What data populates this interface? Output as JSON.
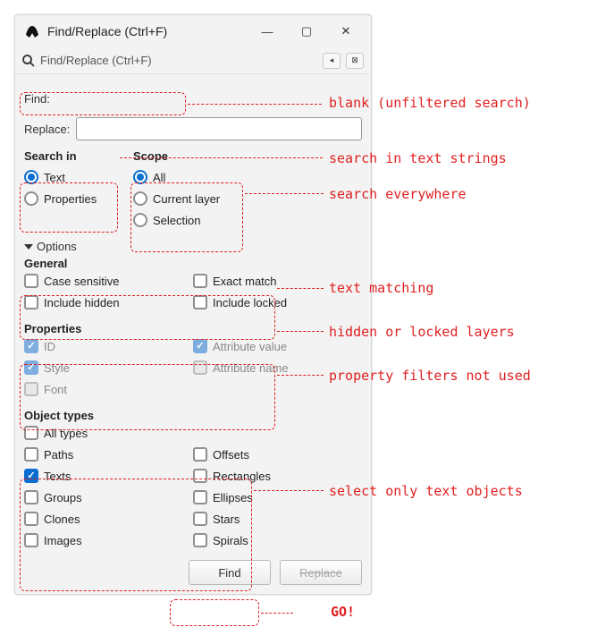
{
  "window": {
    "title": "Find/Replace (Ctrl+F)",
    "minimize_glyph": "—",
    "maximize_glyph": "▢",
    "close_glyph": "✕",
    "sub_title": "Find/Replace (Ctrl+F)",
    "back_glyph": "◂",
    "subclose_glyph": "⊠"
  },
  "fields": {
    "find_label": "Find:",
    "find_value": "",
    "replace_label": "Replace:",
    "replace_value": ""
  },
  "search_in": {
    "header": "Search in",
    "text": "Text",
    "properties": "Properties"
  },
  "scope": {
    "header": "Scope",
    "all": "All",
    "current_layer": "Current layer",
    "selection": "Selection"
  },
  "options_header": "Options",
  "general": {
    "header": "General",
    "case_sensitive": "Case sensitive",
    "exact_match": "Exact match",
    "include_hidden": "Include hidden",
    "include_locked": "Include locked"
  },
  "properties": {
    "header": "Properties",
    "id": "ID",
    "attr_value": "Attribute value",
    "style": "Style",
    "attr_name": "Attribute name",
    "font": "Font"
  },
  "object_types": {
    "header": "Object types",
    "all_types": "All types",
    "paths": "Paths",
    "offsets": "Offsets",
    "texts": "Texts",
    "rectangles": "Rectangles",
    "groups": "Groups",
    "ellipses": "Ellipses",
    "clones": "Clones",
    "stars": "Stars",
    "images": "Images",
    "spirals": "Spirals"
  },
  "buttons": {
    "find": "Find",
    "replace": "Replace"
  },
  "annotations": {
    "blank": "blank (unfiltered search)",
    "search_text": "search in text strings",
    "search_everywhere": "search everywhere",
    "text_matching": "text matching",
    "hidden_locked": "hidden or locked layers",
    "prop_filters": "property filters not used",
    "text_objects": "select only text objects",
    "go": "GO!"
  }
}
